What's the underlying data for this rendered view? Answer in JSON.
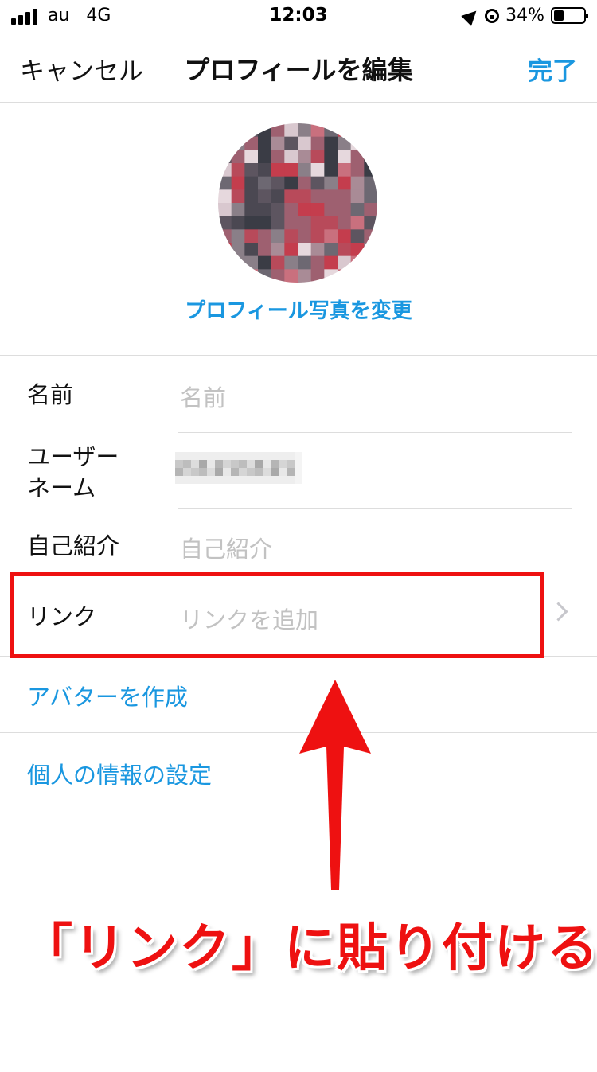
{
  "status_bar": {
    "carrier": "au",
    "network": "4G",
    "time": "12:03",
    "battery": "34%",
    "battery_level": 0.34
  },
  "nav": {
    "cancel_label": "キャンセル",
    "title": "プロフィールを編集",
    "done_label": "完了"
  },
  "profile": {
    "change_photo_label": "プロフィール写真を変更"
  },
  "fields": {
    "name": {
      "label": "名前",
      "placeholder": "名前"
    },
    "username": {
      "label_line1": "ユーザー",
      "label_line2": "ネーム"
    },
    "bio": {
      "label": "自己紹介",
      "placeholder": "自己紹介"
    },
    "link": {
      "label": "リンク",
      "placeholder": "リンクを追加"
    }
  },
  "actions": {
    "avatar_label": "アバターを作成",
    "personal_info_label": "個人の情報の設定"
  },
  "annotation": {
    "caption": "「リンク」に貼り付ける",
    "color": "#ee1111"
  },
  "colors": {
    "accent": "#1a97e0"
  }
}
